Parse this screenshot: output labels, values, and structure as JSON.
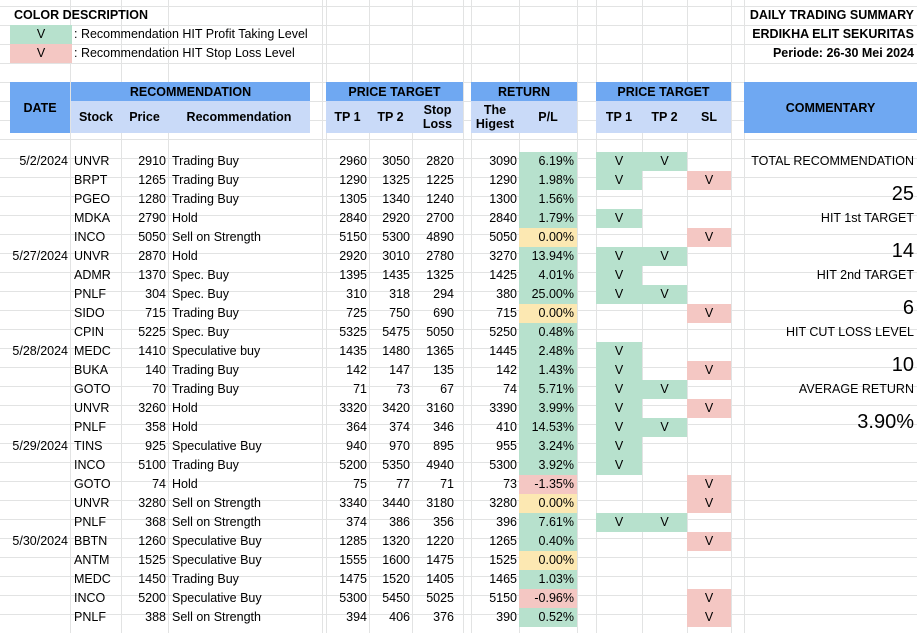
{
  "legend": {
    "title": "COLOR DESCRIPTION",
    "items": [
      {
        "mark": "V",
        "text": ": Recommendation HIT Profit Taking Level",
        "color": "#b7e1cd"
      },
      {
        "mark": "V",
        "text": ": Recommendation HIT Stop Loss Level",
        "color": "#f4c7c3"
      }
    ]
  },
  "summary": {
    "title": "DAILY TRADING SUMMARY",
    "company": "ERDIKHA ELIT SEKURITAS",
    "period": "Periode:  26-30 Mei  2024"
  },
  "headers": {
    "date": "DATE",
    "recommendation_group": "RECOMMENDATION",
    "stock": "Stock",
    "price": "Price",
    "recommendation": "Recommendation",
    "price_target_group": "PRICE TARGET",
    "tp1": "TP 1",
    "tp2": "TP 2",
    "stop_loss": "Stop Loss",
    "return_group": "RETURN",
    "highest": "The Higest",
    "pl": "P/L",
    "hit_group": "PRICE TARGET",
    "hit_tp1": "TP 1",
    "hit_tp2": "TP 2",
    "hit_sl": "SL",
    "commentary": "COMMENTARY"
  },
  "colors": {
    "header": "#6fa8f2",
    "subheader": "#c9daf8",
    "green": "#b7e1cd",
    "red": "#f4c7c3",
    "yellow": "#fce8b2"
  },
  "rows": [
    {
      "date": "5/2/2024",
      "stock": "UNVR",
      "price": "2910",
      "rec": "Trading Buy",
      "tp1": "2960",
      "tp2": "3050",
      "sl": "2820",
      "high": "3090",
      "pl": "6.19%",
      "pl_color": "green",
      "h1": "V",
      "h2": "V",
      "hs": ""
    },
    {
      "date": "",
      "stock": "BRPT",
      "price": "1265",
      "rec": "Trading Buy",
      "tp1": "1290",
      "tp2": "1325",
      "sl": "1225",
      "high": "1290",
      "pl": "1.98%",
      "pl_color": "green",
      "h1": "V",
      "h2": "",
      "hs": "V"
    },
    {
      "date": "",
      "stock": "PGEO",
      "price": "1280",
      "rec": "Trading Buy",
      "tp1": "1305",
      "tp2": "1340",
      "sl": "1240",
      "high": "1300",
      "pl": "1.56%",
      "pl_color": "green",
      "h1": "",
      "h2": "",
      "hs": ""
    },
    {
      "date": "",
      "stock": "MDKA",
      "price": "2790",
      "rec": "Hold",
      "tp1": "2840",
      "tp2": "2920",
      "sl": "2700",
      "high": "2840",
      "pl": "1.79%",
      "pl_color": "green",
      "h1": "V",
      "h2": "",
      "hs": ""
    },
    {
      "date": "",
      "stock": "INCO",
      "price": "5050",
      "rec": "Sell on Strength",
      "tp1": "5150",
      "tp2": "5300",
      "sl": "4890",
      "high": "5050",
      "pl": "0.00%",
      "pl_color": "yellow",
      "h1": "",
      "h2": "",
      "hs": "V"
    },
    {
      "date": "5/27/2024",
      "stock": "UNVR",
      "price": "2870",
      "rec": "Hold",
      "tp1": "2920",
      "tp2": "3010",
      "sl": "2780",
      "high": "3270",
      "pl": "13.94%",
      "pl_color": "green",
      "h1": "V",
      "h2": "V",
      "hs": ""
    },
    {
      "date": "",
      "stock": "ADMR",
      "price": "1370",
      "rec": "Spec. Buy",
      "tp1": "1395",
      "tp2": "1435",
      "sl": "1325",
      "high": "1425",
      "pl": "4.01%",
      "pl_color": "green",
      "h1": "V",
      "h2": "",
      "hs": ""
    },
    {
      "date": "",
      "stock": "PNLF",
      "price": "304",
      "rec": "Spec. Buy",
      "tp1": "310",
      "tp2": "318",
      "sl": "294",
      "high": "380",
      "pl": "25.00%",
      "pl_color": "green",
      "h1": "V",
      "h2": "V",
      "hs": ""
    },
    {
      "date": "",
      "stock": "SIDO",
      "price": "715",
      "rec": "Trading Buy",
      "tp1": "725",
      "tp2": "750",
      "sl": "690",
      "high": "715",
      "pl": "0.00%",
      "pl_color": "yellow",
      "h1": "",
      "h2": "",
      "hs": "V"
    },
    {
      "date": "",
      "stock": "CPIN",
      "price": "5225",
      "rec": "Spec. Buy",
      "tp1": "5325",
      "tp2": "5475",
      "sl": "5050",
      "high": "5250",
      "pl": "0.48%",
      "pl_color": "green",
      "h1": "",
      "h2": "",
      "hs": ""
    },
    {
      "date": "5/28/2024",
      "stock": "MEDC",
      "price": "1410",
      "rec": "Speculative buy",
      "tp1": "1435",
      "tp2": "1480",
      "sl": "1365",
      "high": "1445",
      "pl": "2.48%",
      "pl_color": "green",
      "h1": "V",
      "h2": "",
      "hs": ""
    },
    {
      "date": "",
      "stock": "BUKA",
      "price": "140",
      "rec": "Trading Buy",
      "tp1": "142",
      "tp2": "147",
      "sl": "135",
      "high": "142",
      "pl": "1.43%",
      "pl_color": "green",
      "h1": "V",
      "h2": "",
      "hs": "V"
    },
    {
      "date": "",
      "stock": "GOTO",
      "price": "70",
      "rec": "Trading Buy",
      "tp1": "71",
      "tp2": "73",
      "sl": "67",
      "high": "74",
      "pl": "5.71%",
      "pl_color": "green",
      "h1": "V",
      "h2": "V",
      "hs": ""
    },
    {
      "date": "",
      "stock": "UNVR",
      "price": "3260",
      "rec": "Hold",
      "tp1": "3320",
      "tp2": "3420",
      "sl": "3160",
      "high": "3390",
      "pl": "3.99%",
      "pl_color": "green",
      "h1": "V",
      "h2": "",
      "hs": "V"
    },
    {
      "date": "",
      "stock": "PNLF",
      "price": "358",
      "rec": "Hold",
      "tp1": "364",
      "tp2": "374",
      "sl": "346",
      "high": "410",
      "pl": "14.53%",
      "pl_color": "green",
      "h1": "V",
      "h2": "V",
      "hs": ""
    },
    {
      "date": "5/29/2024",
      "stock": "TINS",
      "price": "925",
      "rec": "Speculative Buy",
      "tp1": "940",
      "tp2": "970",
      "sl": "895",
      "high": "955",
      "pl": "3.24%",
      "pl_color": "green",
      "h1": "V",
      "h2": "",
      "hs": ""
    },
    {
      "date": "",
      "stock": "INCO",
      "price": "5100",
      "rec": "Trading Buy",
      "tp1": "5200",
      "tp2": "5350",
      "sl": "4940",
      "high": "5300",
      "pl": "3.92%",
      "pl_color": "green",
      "h1": "V",
      "h2": "",
      "hs": ""
    },
    {
      "date": "",
      "stock": "GOTO",
      "price": "74",
      "rec": "Hold",
      "tp1": "75",
      "tp2": "77",
      "sl": "71",
      "high": "73",
      "pl": "-1.35%",
      "pl_color": "red",
      "h1": "",
      "h2": "",
      "hs": "V"
    },
    {
      "date": "",
      "stock": "UNVR",
      "price": "3280",
      "rec": "Sell on Strength",
      "tp1": "3340",
      "tp2": "3440",
      "sl": "3180",
      "high": "3280",
      "pl": "0.00%",
      "pl_color": "yellow",
      "h1": "",
      "h2": "",
      "hs": "V"
    },
    {
      "date": "",
      "stock": "PNLF",
      "price": "368",
      "rec": "Sell on Strength",
      "tp1": "374",
      "tp2": "386",
      "sl": "356",
      "high": "396",
      "pl": "7.61%",
      "pl_color": "green",
      "h1": "V",
      "h2": "V",
      "hs": ""
    },
    {
      "date": "5/30/2024",
      "stock": "BBTN",
      "price": "1260",
      "rec": "Speculative Buy",
      "tp1": "1285",
      "tp2": "1320",
      "sl": "1220",
      "high": "1265",
      "pl": "0.40%",
      "pl_color": "green",
      "h1": "",
      "h2": "",
      "hs": "V"
    },
    {
      "date": "",
      "stock": "ANTM",
      "price": "1525",
      "rec": "Speculative Buy",
      "tp1": "1555",
      "tp2": "1600",
      "sl": "1475",
      "high": "1525",
      "pl": "0.00%",
      "pl_color": "yellow",
      "h1": "",
      "h2": "",
      "hs": ""
    },
    {
      "date": "",
      "stock": "MEDC",
      "price": "1450",
      "rec": "Trading Buy",
      "tp1": "1475",
      "tp2": "1520",
      "sl": "1405",
      "high": "1465",
      "pl": "1.03%",
      "pl_color": "green",
      "h1": "",
      "h2": "",
      "hs": ""
    },
    {
      "date": "",
      "stock": "INCO",
      "price": "5200",
      "rec": "Speculative Buy",
      "tp1": "5300",
      "tp2": "5450",
      "sl": "5025",
      "high": "5150",
      "pl": "-0.96%",
      "pl_color": "red",
      "h1": "",
      "h2": "",
      "hs": "V"
    },
    {
      "date": "",
      "stock": "PNLF",
      "price": "388",
      "rec": "Sell on Strength",
      "tp1": "394",
      "tp2": "406",
      "sl": "376",
      "high": "390",
      "pl": "0.52%",
      "pl_color": "green",
      "h1": "",
      "h2": "",
      "hs": "V"
    }
  ],
  "commentary": [
    {
      "label": "TOTAL RECOMMENDATION",
      "value": "25"
    },
    {
      "label": "HIT 1st TARGET",
      "value": "14"
    },
    {
      "label": "HIT 2nd TARGET",
      "value": "6"
    },
    {
      "label": "HIT CUT LOSS LEVEL",
      "value": "10"
    },
    {
      "label": "AVERAGE RETURN",
      "value": "3.90%"
    }
  ]
}
